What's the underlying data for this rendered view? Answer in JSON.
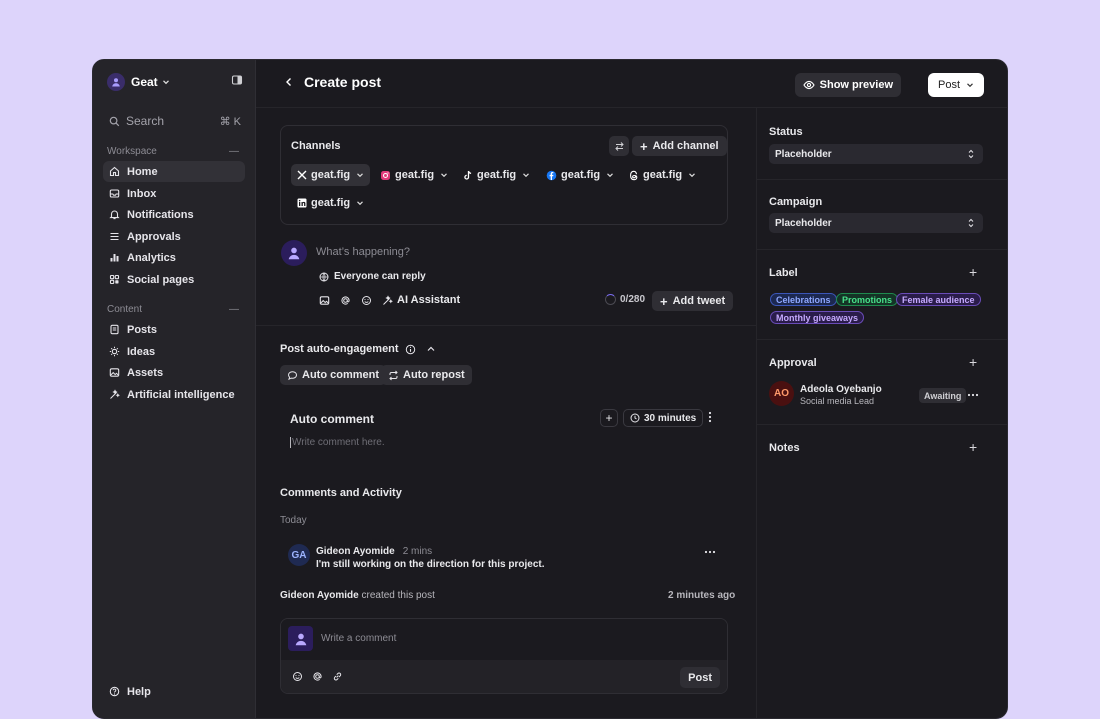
{
  "workspace": {
    "name": "Geat"
  },
  "search": {
    "label": "Search",
    "shortcut": "⌘ K"
  },
  "sidebar": {
    "workspace_label": "Workspace",
    "workspace_items": [
      {
        "label": "Home",
        "icon": "home-icon"
      },
      {
        "label": "Inbox",
        "icon": "inbox-icon"
      },
      {
        "label": "Notifications",
        "icon": "bell-icon"
      },
      {
        "label": "Approvals",
        "icon": "list-icon"
      },
      {
        "label": "Analytics",
        "icon": "bar-chart-icon"
      },
      {
        "label": "Social pages",
        "icon": "grid-icon"
      }
    ],
    "content_label": "Content",
    "content_items": [
      {
        "label": "Posts",
        "icon": "document-icon"
      },
      {
        "label": "Ideas",
        "icon": "lightbulb-icon"
      },
      {
        "label": "Assets",
        "icon": "image-icon"
      },
      {
        "label": "Artificial intelligence",
        "icon": "sparkle-icon"
      }
    ],
    "help_label": "Help"
  },
  "header": {
    "title": "Create post",
    "preview_label": "Show preview",
    "post_label": "Post"
  },
  "channels": {
    "title": "Channels",
    "add_label": "Add channel",
    "items": [
      {
        "network": "X",
        "label": "geat.fig"
      },
      {
        "network": "Instagram",
        "label": "geat.fig"
      },
      {
        "network": "TikTok",
        "label": "geat.fig"
      },
      {
        "network": "Facebook",
        "label": "geat.fig"
      },
      {
        "network": "Threads",
        "label": "geat.fig"
      },
      {
        "network": "LinkedIn",
        "label": "geat.fig"
      }
    ]
  },
  "composer": {
    "placeholder": "What’s happening?",
    "reply_setting": "Everyone can reply",
    "ai_label": "AI Assistant",
    "counter": "0/280",
    "add_tweet_label": "Add tweet"
  },
  "auto_engagement": {
    "title": "Post auto-engagement",
    "auto_comment_label": "Auto comment",
    "auto_repost_label": "Auto repost",
    "panel_title": "Auto comment",
    "delay": "30 minutes",
    "input_placeholder": "Write comment here."
  },
  "activity": {
    "title": "Comments and Activity",
    "day": "Today",
    "comment": {
      "initials": "GA",
      "author": "Gideon Ayomide",
      "time": "2 mins",
      "text": "I'm still working on the direction for this project."
    },
    "event_actor": "Gideon Ayomide",
    "event_text": "created this post",
    "event_time": "2 minutes ago",
    "input_placeholder": "Write a comment",
    "post_label": "Post"
  },
  "right_panel": {
    "status_label": "Status",
    "status_value": "Placeholder",
    "campaign_label": "Campaign",
    "campaign_value": "Placeholder",
    "label_title": "Label",
    "tags": [
      {
        "label": "Celebrations",
        "color": "#6f8cff"
      },
      {
        "label": "Promotions",
        "color": "#38d27a"
      },
      {
        "label": "Female audience",
        "color": "#b48cff"
      },
      {
        "label": "Monthly giveaways",
        "color": "#b48cff"
      }
    ],
    "approval_title": "Approval",
    "approver": {
      "initials": "AO",
      "name": "Adeola Oyebanjo",
      "role": "Social media Lead",
      "status": "Awaiting"
    },
    "notes_title": "Notes"
  },
  "colors": {
    "page_bg": "#ddd4fb",
    "window_bg": "#1b1a1f",
    "sidebar_bg": "#252429",
    "accent": "#7a6cf0"
  }
}
